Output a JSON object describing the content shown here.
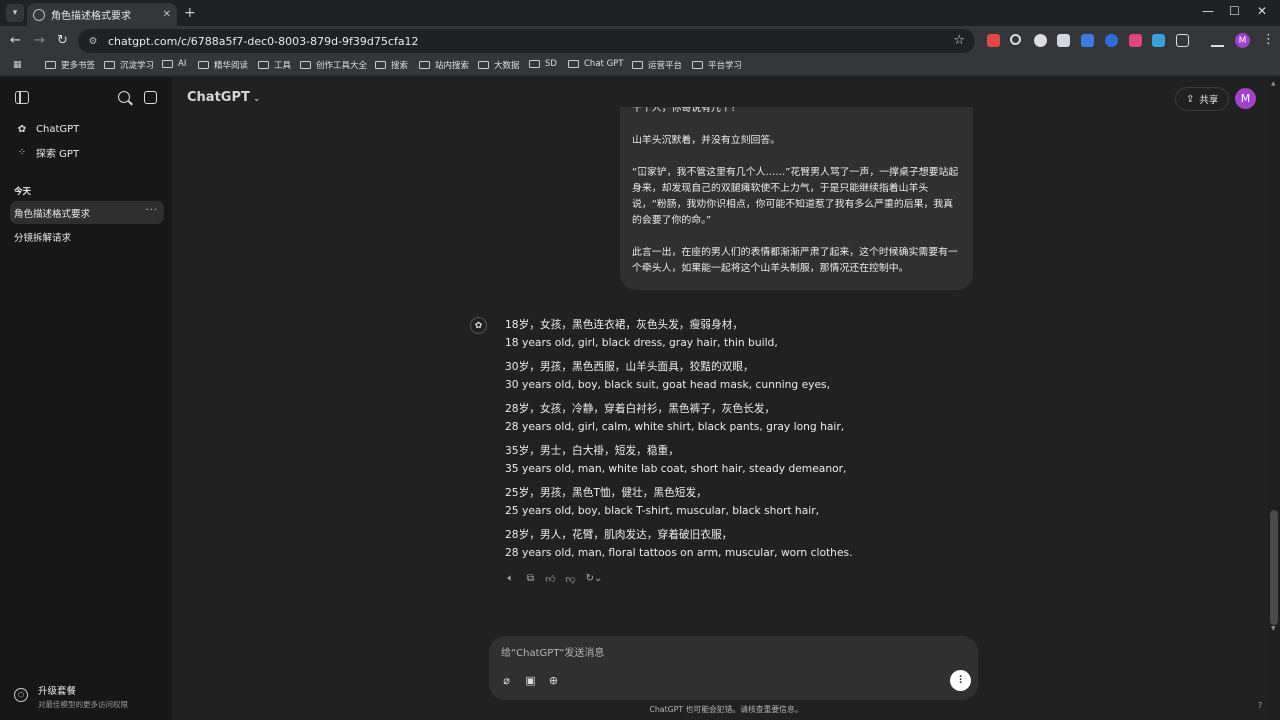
{
  "browser": {
    "tab_title": "角色描述格式要求",
    "url": "chatgpt.com/c/6788a5f7-dec0-8003-879d-9f39d75cfa12",
    "profile_initial": "M",
    "bookmarks": [
      "更多书签",
      "沉淀学习",
      "AI",
      "精华阅读",
      "工具",
      "创作工具大全",
      "搜索",
      "站内搜索",
      "大数据",
      "SD",
      "Chat GPT",
      "运营平台",
      "平台学习"
    ]
  },
  "sidebar": {
    "nav": [
      {
        "label": "ChatGPT",
        "icon": "chatgpt-logo-icon"
      },
      {
        "label": "探索 GPT",
        "icon": "grid-icon"
      }
    ],
    "section_today": "今天",
    "conversations": [
      {
        "label": "角色描述格式要求",
        "active": true
      },
      {
        "label": "分镜拆解请求",
        "active": false
      }
    ],
    "upgrade": {
      "title": "升级套餐",
      "subtitle": "对最佳模型的更多访问权限"
    }
  },
  "header": {
    "model": "ChatGPT",
    "share_label": "共享",
    "avatar_initial": "M"
  },
  "user_message": {
    "lines_top": "十个人，你哥说有几个？",
    "paragraphs": [
      "山羊头沉默着，并没有立刻回答。",
      "“冚家铲，我不管这里有几个人……”花臂男人骂了一声，一撑桌子想要站起身来，却发现自己的双腿瘫软使不上力气，于是只能继续指着山羊头说，“粉肠，我劝你识相点，你可能不知道惹了我有多么严重的后果，我真的会要了你的命。”",
      "此言一出，在座的男人们的表情都渐渐严肃了起来，这个时候确实需要有一个牵头人，如果能一起将这个山羊头制服，那情况还在控制中。"
    ]
  },
  "assistant_reply": [
    {
      "zh": "18岁，女孩，黑色连衣裙，灰色头发，瘦弱身材，",
      "en": "18 years old, girl, black dress, gray hair, thin build,"
    },
    {
      "zh": "30岁，男孩，黑色西服，山羊头面具，狡黠的双眼，",
      "en": "30 years old, boy, black suit, goat head mask, cunning eyes,"
    },
    {
      "zh": "28岁，女孩，冷静，穿着白衬衫，黑色裤子，灰色长发，",
      "en": "28 years old, girl, calm, white shirt, black pants, gray long hair,"
    },
    {
      "zh": "35岁，男士，白大褂，短发，稳重，",
      "en": "35 years old, man, white lab coat, short hair, steady demeanor,"
    },
    {
      "zh": "25岁，男孩，黑色T恤，健壮，黑色短发，",
      "en": "25 years old, boy, black T-shirt, muscular, black short hair,"
    },
    {
      "zh": "28岁，男人，花臂，肌肉发达，穿着破旧衣服，",
      "en": "28 years old, man, floral tattoos on arm, muscular, worn clothes."
    }
  ],
  "composer": {
    "placeholder": "给“ChatGPT”发送消息",
    "disclaimer": "ChatGPT 也可能会犯错。请核查重要信息。",
    "help": "?"
  },
  "colors": {
    "accent_avatar": "#a142c9",
    "sidebar_bg": "#171717",
    "main_bg": "#212121",
    "bubble_bg": "#303030"
  }
}
